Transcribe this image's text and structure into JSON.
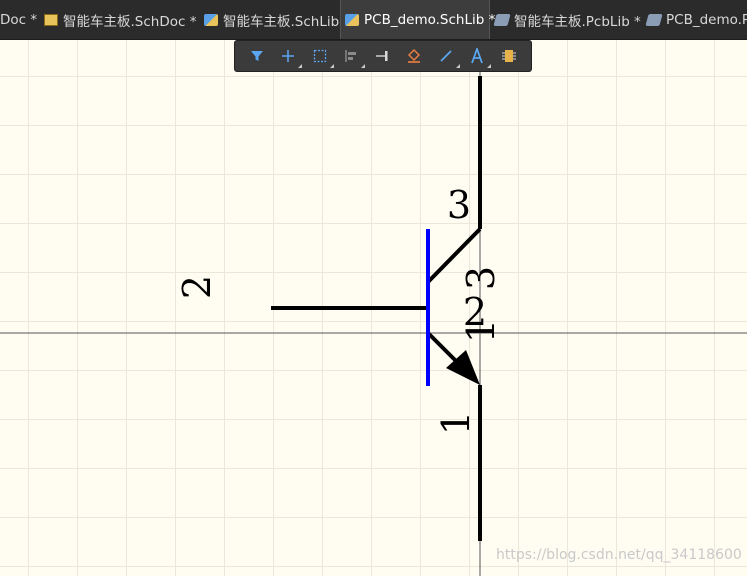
{
  "tabs": [
    {
      "label": "Doc *",
      "icon": "sch-doc-icon",
      "active": false
    },
    {
      "label": "智能车主板.SchDoc *",
      "icon": "sch-doc-icon",
      "active": false
    },
    {
      "label": "智能车主板.SchLib",
      "icon": "sch-lib-icon",
      "active": false
    },
    {
      "label": "PCB_demo.SchLib *",
      "icon": "sch-lib-icon",
      "active": true
    },
    {
      "label": "智能车主板.PcbLib *",
      "icon": "pcb-lib-icon",
      "active": false
    },
    {
      "label": "PCB_demo.Pc",
      "icon": "pcb-lib-icon",
      "active": false
    }
  ],
  "toolbar": {
    "tools": [
      "filter-icon",
      "add-icon",
      "select-rect-icon",
      "align-icon",
      "place-pin-icon",
      "fill-icon",
      "line-icon",
      "text-icon",
      "component-icon"
    ]
  },
  "schematic": {
    "pin_labels": {
      "base_outer": "2",
      "collector_outer": "3",
      "emitter_outer": "1",
      "collector_inner": "3",
      "base_inner": "2",
      "emitter_inner": "1"
    },
    "colors": {
      "wire": "#000000",
      "body_bar": "#0000ff",
      "axis": "#555555"
    }
  },
  "watermark": "https://blog.csdn.net/qq_34118600"
}
